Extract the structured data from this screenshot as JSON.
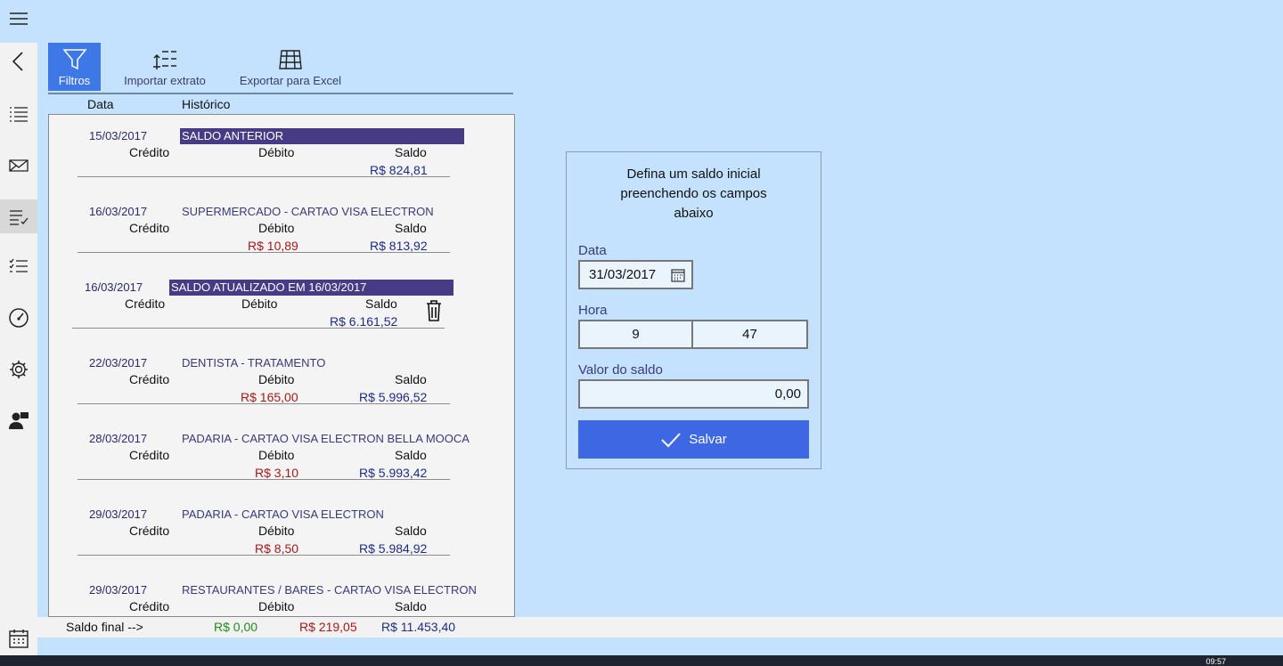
{
  "nav": {
    "items": [
      {
        "name": "menu-icon"
      },
      {
        "name": "back-icon"
      },
      {
        "name": "list-icon"
      },
      {
        "name": "mail-icon"
      },
      {
        "name": "checklist-icon",
        "active": true
      },
      {
        "name": "tasks-icon"
      },
      {
        "name": "gauge-icon"
      },
      {
        "name": "gear-icon"
      },
      {
        "name": "user-icon"
      },
      {
        "name": "calendar-icon"
      }
    ]
  },
  "toolbar": {
    "filtros": "Filtros",
    "importar": "Importar extrato",
    "exportar": "Exportar para Excel"
  },
  "columns": {
    "data": "Data",
    "historico": "Histórico"
  },
  "labels": {
    "credito": "Crédito",
    "debito": "Débito",
    "saldo": "Saldo"
  },
  "entries": [
    {
      "date": "15/03/2017",
      "hist": "SALDO ANTERIOR",
      "highlight": true,
      "credito": "",
      "debito": "",
      "saldo": "R$ 824,81"
    },
    {
      "date": "16/03/2017",
      "hist": "SUPERMERCADO - CARTAO VISA ELECTRON",
      "highlight": false,
      "credito": "",
      "debito": "R$ 10,89",
      "saldo": "R$ 813,92"
    },
    {
      "date": "16/03/2017",
      "hist": "SALDO ATUALIZADO EM 16/03/2017",
      "highlight": true,
      "credito": "",
      "debito": "",
      "saldo": "R$ 6.161,52"
    },
    {
      "date": "22/03/2017",
      "hist": "DENTISTA - TRATAMENTO",
      "highlight": false,
      "credito": "",
      "debito": "R$ 165,00",
      "saldo": "R$ 5.996,52"
    },
    {
      "date": "28/03/2017",
      "hist": "PADARIA - CARTAO VISA ELECTRON BELLA MOOCA",
      "highlight": false,
      "credito": "",
      "debito": "R$ 3,10",
      "saldo": "R$ 5.993,42"
    },
    {
      "date": "29/03/2017",
      "hist": "PADARIA - CARTAO VISA ELECTRON",
      "highlight": false,
      "credito": "",
      "debito": "R$ 8,50",
      "saldo": "R$ 5.984,92"
    },
    {
      "date": "29/03/2017",
      "hist": "RESTAURANTES / BARES - CARTAO VISA ELECTRON",
      "highlight": false,
      "credito": "",
      "debito": "",
      "saldo": ""
    }
  ],
  "footer": {
    "label": "Saldo final -->",
    "credito": "R$ 0,00",
    "debito": "R$ 219,05",
    "saldo": "R$ 11.453,40"
  },
  "form": {
    "title_line1": "Defina um saldo inicial",
    "title_line2": "preenchendo os campos",
    "title_line3": "abaixo",
    "data_label": "Data",
    "data_value": "31/03/2017",
    "hora_label": "Hora",
    "hora_value": "9",
    "minuto_value": "47",
    "valor_label": "Valor do saldo",
    "valor_value": "0,00",
    "salvar": "Salvar"
  },
  "taskbar": {
    "clock": "09:57"
  },
  "colors": {
    "background": "#c4e2fd",
    "accent": "#3d67e3",
    "highlight": "#473b86",
    "debit": "#a81818",
    "saldo": "#1d2d86",
    "credit": "#1f8a1f"
  }
}
